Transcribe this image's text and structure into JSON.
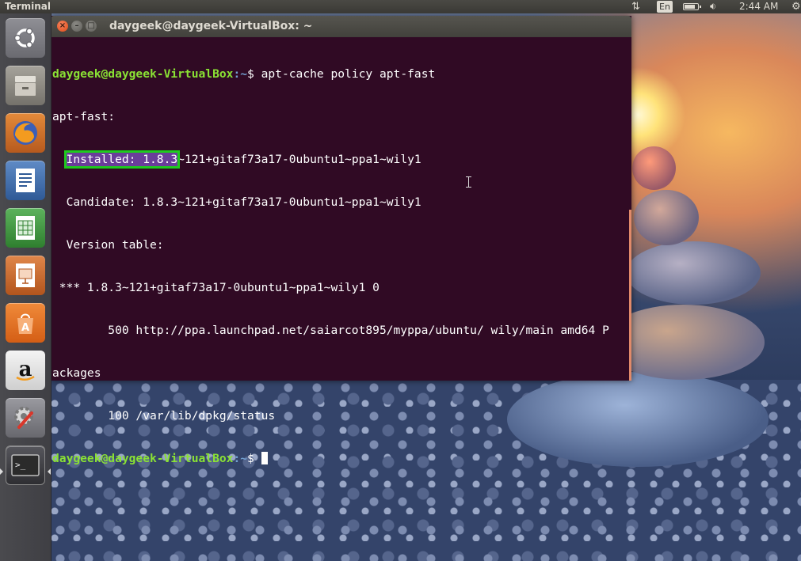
{
  "top_panel": {
    "app_name": "Terminal",
    "language": "En",
    "time": "2:44 AM"
  },
  "launcher": {
    "items": [
      {
        "name": "Dash home",
        "icon": "ubuntu-logo-icon"
      },
      {
        "name": "Files",
        "icon": "files-icon"
      },
      {
        "name": "Firefox Web Browser",
        "icon": "firefox-icon"
      },
      {
        "name": "LibreOffice Writer",
        "icon": "writer-icon"
      },
      {
        "name": "LibreOffice Calc",
        "icon": "calc-icon"
      },
      {
        "name": "LibreOffice Impress",
        "icon": "impress-icon"
      },
      {
        "name": "Ubuntu Software Center",
        "icon": "software-center-icon"
      },
      {
        "name": "Amazon",
        "icon": "amazon-icon"
      },
      {
        "name": "System Settings",
        "icon": "settings-icon"
      },
      {
        "name": "Terminal",
        "icon": "terminal-icon",
        "active": true
      }
    ],
    "amazon_letter": "a",
    "terminal_glyph": ">_",
    "software_letter": "A"
  },
  "terminal": {
    "title": "daygeek@daygeek-VirtualBox: ~",
    "prompt_user": "daygeek@daygeek-VirtualBox",
    "prompt_path": ":~",
    "prompt_symbol": "$ ",
    "command": "apt-cache policy apt-fast",
    "output": {
      "line1": "apt-fast:",
      "installed_indent": "  ",
      "installed_highlight": "Installed: 1.8.3",
      "installed_rest": "~121+gitaf73a17-0ubuntu1~ppa1~wily1",
      "candidate": "  Candidate: 1.8.3~121+gitaf73a17-0ubuntu1~ppa1~wily1",
      "version_table": "  Version table:",
      "version_entry": " *** 1.8.3~121+gitaf73a17-0ubuntu1~ppa1~wily1 0",
      "source_line_a": "        500 http://ppa.launchpad.net/saiarcot895/myppa/ubuntu/ wily/main amd64 P",
      "source_line_b": "ackages",
      "status_line": "        100 /var/lib/dpkg/status"
    },
    "colors": {
      "background": "#300a24",
      "prompt_user": "#8ae234",
      "prompt_path": "#729fcf",
      "highlight_box": "#1ecb1e",
      "highlight_fill": "#6a3d9a"
    }
  }
}
